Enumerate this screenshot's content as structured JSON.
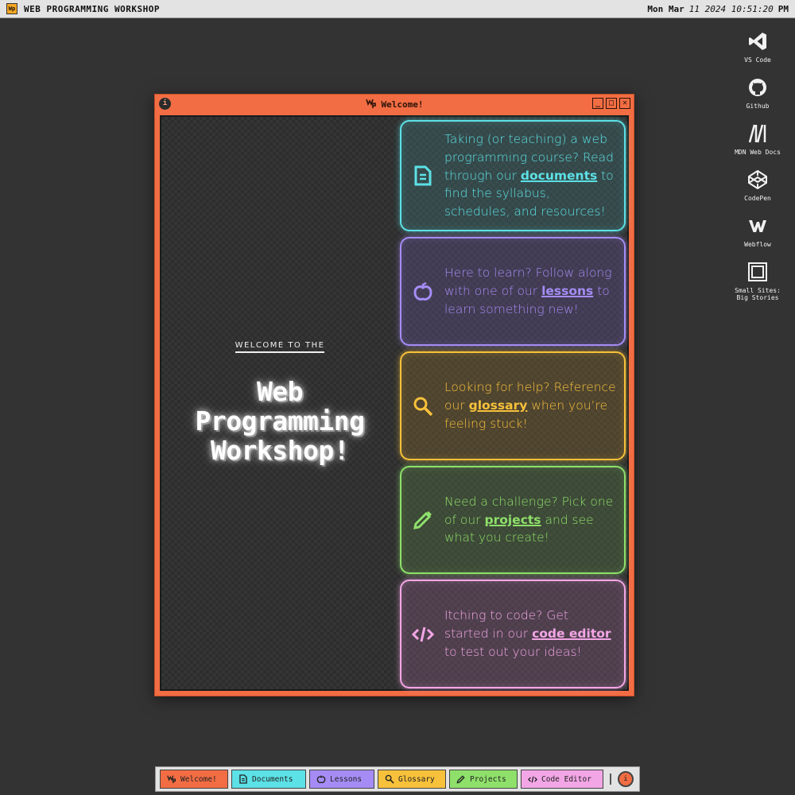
{
  "topbar": {
    "title": "WEB PROGRAMMING WORKSHOP",
    "logo_text": "Wp",
    "date": "Mon Mar",
    "date_italic": "11 2024 10:51:20",
    "ampm": "PM"
  },
  "desktop_icons": [
    {
      "label": "VS Code",
      "icon": "vscode-icon"
    },
    {
      "label": "Github",
      "icon": "github-icon"
    },
    {
      "label": "MDN Web Docs",
      "icon": "mdn-icon"
    },
    {
      "label": "CodePen",
      "icon": "codepen-icon"
    },
    {
      "label": "Webflow",
      "icon": "webflow-icon"
    },
    {
      "label": "Small Sites: Big Stories",
      "icon": "square-frame-icon"
    }
  ],
  "window": {
    "title": "Welcome!",
    "info_glyph": "i",
    "minimize": "_",
    "maximize": "□",
    "close": "✕"
  },
  "hero": {
    "kicker": "WELCOME TO THE",
    "title_line1": "Web",
    "title_line2": "Programming",
    "title_line3": "Workshop!"
  },
  "cards": {
    "documents": {
      "pre": "Taking (or teaching) a web programming course? Read through our ",
      "link": "documents",
      "post": " to find the syllabus, schedules, and resources!"
    },
    "lessons": {
      "pre": "Here to learn? Follow along with one of our ",
      "link": "lessons",
      "post": " to learn something new!"
    },
    "glossary": {
      "pre": "Looking for help? Reference our ",
      "link": "glossary",
      "post": " when you’re feeling stuck!"
    },
    "projects": {
      "pre": "Need a challenge? Pick one of our ",
      "link": "projects",
      "post": " and see what you create!"
    },
    "code": {
      "pre": "Itching to code? Get started in our ",
      "link": "code editor",
      "post": " to test out your ideas!"
    }
  },
  "taskbar": {
    "items": [
      {
        "label": "Welcome!"
      },
      {
        "label": "Documents"
      },
      {
        "label": "Lessons"
      },
      {
        "label": "Glossary"
      },
      {
        "label": "Projects"
      },
      {
        "label": "Code Editor"
      }
    ],
    "info_glyph": "i"
  },
  "colors": {
    "window_accent": "#f26d43",
    "documents": "#5ce1e6",
    "lessons": "#a58cf5",
    "glossary": "#f7c13b",
    "projects": "#8ee06a",
    "code": "#f3a6e6",
    "desktop_bg": "#333333"
  }
}
